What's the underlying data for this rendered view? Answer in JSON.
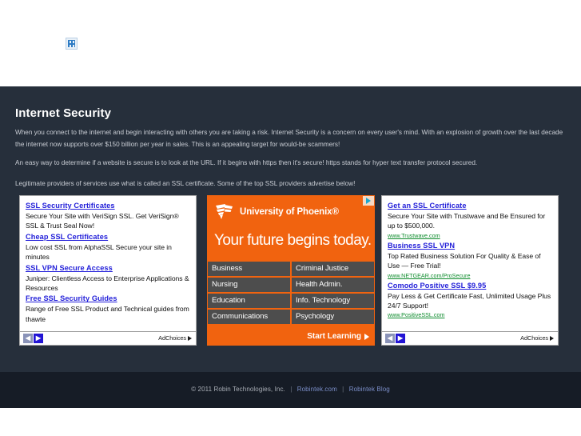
{
  "header": {
    "logo_icon": "broken-image-icon"
  },
  "main": {
    "title": "Internet Security",
    "paragraphs": [
      "When you connect to the internet and begin interacting with others you are taking a risk. Internet Security is a concern on every user's mind. With an explosion of growth over the last decade the internet now supports over $150 billion per year in sales. This is an appealing target for would-be scammers!",
      "An easy way to determine if a website is secure is to look at the URL. If it begins with https then it's secure! https stands for hyper text transfer protocol secured.",
      "Legitimate providers of services use what is called an SSL certificate. Some of the top SSL providers advertise below!"
    ]
  },
  "ads": {
    "left": {
      "items": [
        {
          "title": "SSL Security Certificates",
          "desc": "Secure Your Site with VeriSign SSL. Get VeriSign® SSL & Trust Seal Now!",
          "url": ""
        },
        {
          "title": "Cheap SSL Certificates",
          "desc": "Low cost SSL from AlphaSSL Secure your site in minutes",
          "url": ""
        },
        {
          "title": "SSL VPN Secure Access",
          "desc": "Juniper: Clientless Access to Enterprise Applications & Resources",
          "url": ""
        },
        {
          "title": "Free SSL Security Guides",
          "desc": "Range of Free SSL Product and Technical guides from thawte",
          "url": ""
        }
      ],
      "prev_label": "◀",
      "next_label": "▶",
      "adchoices_label": "AdChoices"
    },
    "center": {
      "brand": "University of Phoenix®",
      "tagline": "Your future begins today.",
      "programs": [
        "Business",
        "Criminal Justice",
        "Nursing",
        "Health Admin.",
        "Education",
        "Info. Technology",
        "Communications",
        "Psychology"
      ],
      "cta": "Start Learning",
      "bg_color": "#f1630f",
      "cell_color": "#4d4d4d"
    },
    "right": {
      "items": [
        {
          "title": "Get an SSL Certificate",
          "desc": "Secure Your Site with Trustwave and Be Ensured for up to $500,000.",
          "url": "www.Trustwave.com"
        },
        {
          "title": "Business SSL VPN",
          "desc": "Top Rated Business Solution For Quality & Ease of Use — Free Trial!",
          "url": "www.NETGEAR.com/ProSecure"
        },
        {
          "title": "Comodo Positive SSL $9.95",
          "desc": "Pay Less & Get Certificate Fast, Unlimited Usage Plus 24/7 Support!",
          "url": "www.PositiveSSL.com"
        }
      ],
      "prev_label": "◀",
      "next_label": "▶",
      "adchoices_label": "AdChoices"
    }
  },
  "footer": {
    "copyright": "© 2011 Robin Technologies, Inc.",
    "sep": "|",
    "link1": "Robintek.com",
    "link2": "Robintek Blog"
  },
  "colors": {
    "content_bg": "#262f3b",
    "footer_bg": "#161c26",
    "ad_link": "#2320d9",
    "ad_url": "#0f8c2e",
    "accent_orange": "#f1630f"
  }
}
